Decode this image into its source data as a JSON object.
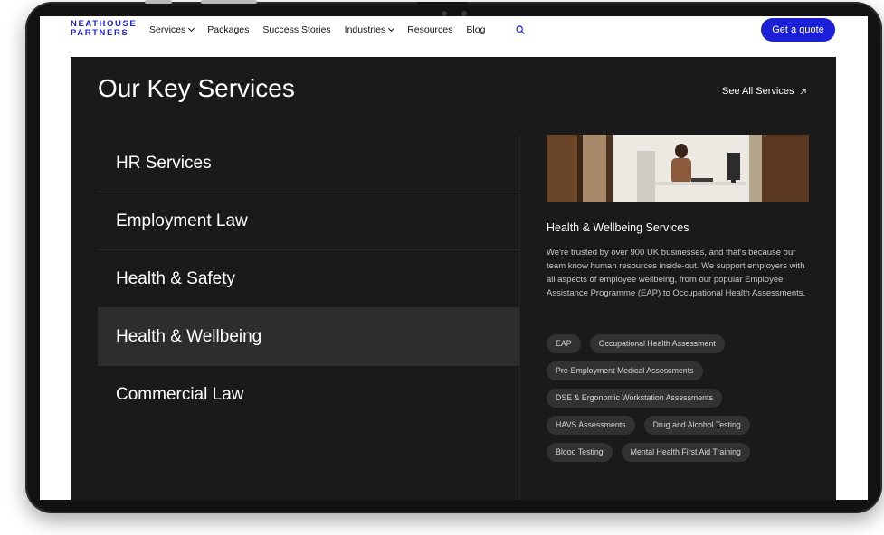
{
  "nav": {
    "logo_line1": "NEATHOUSE",
    "logo_line2": "PARTNERS",
    "items": [
      {
        "label": "Services",
        "dropdown": true
      },
      {
        "label": "Packages",
        "dropdown": false
      },
      {
        "label": "Success Stories",
        "dropdown": false
      },
      {
        "label": "Industries",
        "dropdown": true
      },
      {
        "label": "Resources",
        "dropdown": false
      },
      {
        "label": "Blog",
        "dropdown": false
      }
    ],
    "search_icon": "search-icon",
    "cta_label": "Get a quote"
  },
  "section": {
    "title": "Our Key Services",
    "see_all_label": "See All Services",
    "services": [
      {
        "label": "HR Services",
        "active": false
      },
      {
        "label": "Employment Law",
        "active": false
      },
      {
        "label": "Health & Safety",
        "active": false
      },
      {
        "label": "Health & Wellbeing",
        "active": true
      },
      {
        "label": "Commercial Law",
        "active": false
      }
    ]
  },
  "detail": {
    "title": "Health & Wellbeing Services",
    "description": "We're trusted by over 900 UK businesses, and that's because our team know human resources inside-out. We support employers with all aspects of employee wellbeing, from our popular Employee Assistance Programme (EAP) to Occupational Health Assessments.",
    "tags": [
      "EAP",
      "Occupational Health Assessment",
      "Pre-Employment Medical Assessments",
      "DSE & Ergonomic Workstation Assessments",
      "HAVS Assessments",
      "Drug and Alcohol Testing",
      "Blood Testing",
      "Mental Health First Aid Training"
    ]
  },
  "colors": {
    "brand_blue": "#1b1fd6",
    "panel_bg": "#1a1a1b",
    "active_row": "#2d2d2e",
    "tag_bg": "#323233"
  }
}
